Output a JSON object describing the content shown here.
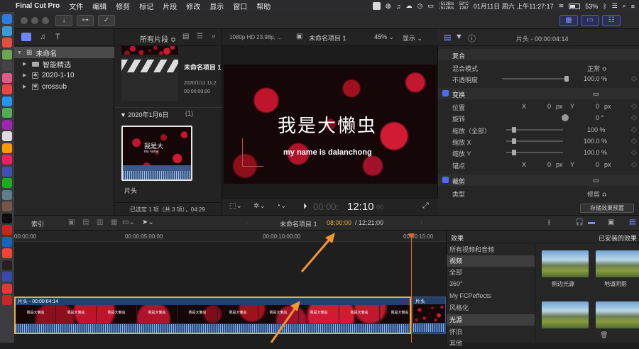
{
  "menubar": {
    "app": "Final Cut Pro",
    "items": [
      "文件",
      "编辑",
      "修剪",
      "标记",
      "片段",
      "修改",
      "显示",
      "窗口",
      "帮助"
    ],
    "net_up": "↑512B/s",
    "net_down": "↓512B/s",
    "cpu_temp": "58°C",
    "fan": "1287",
    "datetime": "01月11日 周六 上午11:27:17",
    "battery": "53%"
  },
  "library": {
    "root": "未命名",
    "items": [
      "智能精选",
      "2020-1-10",
      "crossub"
    ]
  },
  "browser": {
    "filter": "所有片段",
    "project_name": "未命名项目 1",
    "project_date": "2020/1/11 11:2",
    "project_timecode": "00:00:00;00",
    "date_group": "2020年1月6日",
    "date_group_count": "(1)",
    "clip_label": "片头",
    "thumb_title": "我是大",
    "thumb_sub": "my name",
    "status": "已选定 1 项（共 3 项），04:29"
  },
  "viewer": {
    "format": "1080p HD 23.98p, ...",
    "project": "未命名项目 1",
    "zoom": "45%",
    "display_menu": "显示",
    "title_text": "我是大懒虫",
    "subtitle_text": "my name is dalanchong",
    "timecode_dim": "00:00:",
    "timecode": "12:10",
    "timecode_frames": "00"
  },
  "inspector": {
    "title": "片头 - 00:00:04:14",
    "sections": {
      "composite": "复合",
      "blend_mode": "混合模式",
      "blend_value": "正常 ≎",
      "opacity": "不透明度",
      "opacity_value": "100.0 %",
      "transform": "变换",
      "position": "位置",
      "x": "X",
      "y": "Y",
      "px": "px",
      "pos_x": "0",
      "pos_y": "0",
      "rotation": "旋转",
      "rotation_value": "0 °",
      "scale_all": "缩放（全部）",
      "scale_all_value": "100 %",
      "scale_x": "缩放 X",
      "scale_x_value": "100.0 %",
      "scale_y": "缩放 Y",
      "scale_y_value": "100.0 %",
      "anchor": "锚点",
      "anchor_x": "0",
      "anchor_y": "0",
      "crop": "裁剪",
      "type": "类型",
      "type_value": "修剪 ≎",
      "save_preset": "存储效果预置"
    }
  },
  "timeline_bar": {
    "index": "索引",
    "project": "未命名项目 1",
    "current_time": "08:00:00",
    "total_time": "/ 12:21:00"
  },
  "timeline": {
    "ruler": [
      "00:00:00",
      "00:00:05:00:00",
      "00:00:10:00:00",
      "00:00:15:00"
    ],
    "clip1_label": "片头 - 00:00:04:14",
    "clip2_label": "片头",
    "clip_thumb_title": "我是大懒虫",
    "clip_thumb_sub": "my name is dalanchong"
  },
  "effects": {
    "header": "效果",
    "installed": "已安装的效果",
    "categories": [
      "所有视频和音频",
      "视频",
      "全部",
      "360°",
      "My FCPeffects",
      "风格化",
      "光源",
      "怀旧",
      "其他"
    ],
    "thumbs": [
      "侧边光源",
      "地道阴影"
    ]
  },
  "colors": {
    "accent": "#4a6cf7",
    "playhead": "#e8632b",
    "annotation_arrow": "#f5962e"
  }
}
